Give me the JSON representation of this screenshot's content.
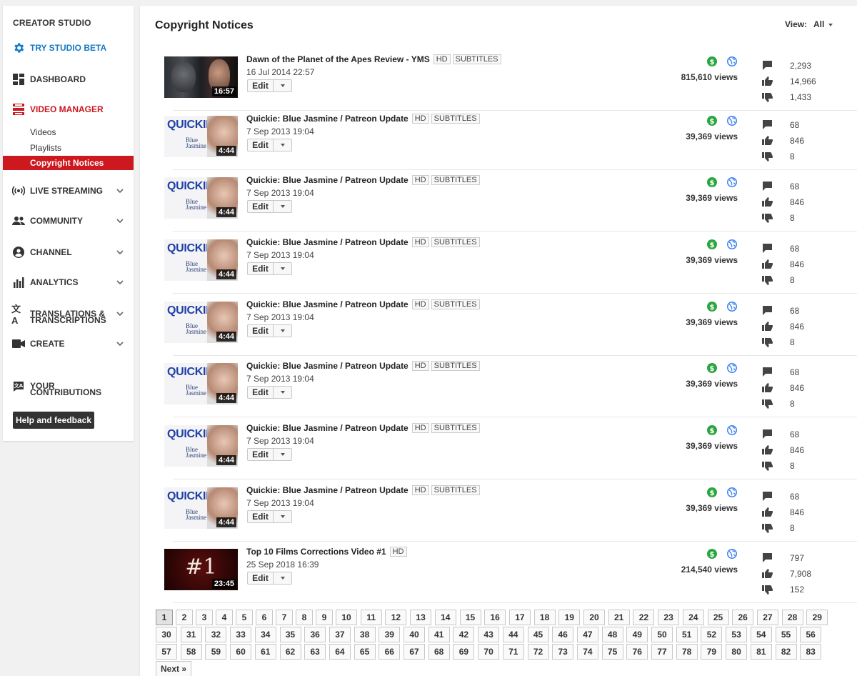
{
  "sidebar": {
    "brand": "CREATOR STUDIO",
    "try_beta": "TRY STUDIO BETA",
    "dashboard": "DASHBOARD",
    "video_manager": "VIDEO MANAGER",
    "sub": {
      "videos": "Videos",
      "playlists": "Playlists",
      "copyright": "Copyright Notices"
    },
    "live": "LIVE STREAMING",
    "community": "COMMUNITY",
    "channel": "CHANNEL",
    "analytics": "ANALYTICS",
    "translations_1": "TRANSLATIONS &",
    "translations_2": "TRANSCRIPTIONS",
    "create": "CREATE",
    "contrib_1": "YOUR",
    "contrib_2": "CONTRIBUTIONS",
    "help": "Help and feedback"
  },
  "header": {
    "title": "Copyright Notices",
    "view_label": "View:",
    "view_value": "All"
  },
  "edit_label": "Edit",
  "colors": {
    "red": "#cc181e",
    "blue": "#167ac6",
    "green": "#2ba640",
    "globe": "#4285f4"
  },
  "videos": [
    {
      "title": "Dawn of the Planet of the Apes Review - YMS",
      "hd": "HD",
      "subtitles": "SUBTITLES",
      "date": "16 Jul 2014 22:57",
      "duration": "16:57",
      "views": "815,610 views",
      "comments": "2,293",
      "likes": "14,966",
      "dislikes": "1,433"
    },
    {
      "title": "Quickie: Blue Jasmine / Patreon Update",
      "hd": "HD",
      "subtitles": "SUBTITLES",
      "date": "7 Sep 2013 19:04",
      "duration": "4:44",
      "views": "39,369 views",
      "comments": "68",
      "likes": "846",
      "dislikes": "8",
      "thumb_word": "QUICKIE"
    },
    {
      "title": "Quickie: Blue Jasmine / Patreon Update",
      "hd": "HD",
      "subtitles": "SUBTITLES",
      "date": "7 Sep 2013 19:04",
      "duration": "4:44",
      "views": "39,369 views",
      "comments": "68",
      "likes": "846",
      "dislikes": "8",
      "thumb_word": "QUICKIE"
    },
    {
      "title": "Quickie: Blue Jasmine / Patreon Update",
      "hd": "HD",
      "subtitles": "SUBTITLES",
      "date": "7 Sep 2013 19:04",
      "duration": "4:44",
      "views": "39,369 views",
      "comments": "68",
      "likes": "846",
      "dislikes": "8",
      "thumb_word": "QUICKIE"
    },
    {
      "title": "Quickie: Blue Jasmine / Patreon Update",
      "hd": "HD",
      "subtitles": "SUBTITLES",
      "date": "7 Sep 2013 19:04",
      "duration": "4:44",
      "views": "39,369 views",
      "comments": "68",
      "likes": "846",
      "dislikes": "8",
      "thumb_word": "QUICKIE"
    },
    {
      "title": "Quickie: Blue Jasmine / Patreon Update",
      "hd": "HD",
      "subtitles": "SUBTITLES",
      "date": "7 Sep 2013 19:04",
      "duration": "4:44",
      "views": "39,369 views",
      "comments": "68",
      "likes": "846",
      "dislikes": "8",
      "thumb_word": "QUICKIE"
    },
    {
      "title": "Quickie: Blue Jasmine / Patreon Update",
      "hd": "HD",
      "subtitles": "SUBTITLES",
      "date": "7 Sep 2013 19:04",
      "duration": "4:44",
      "views": "39,369 views",
      "comments": "68",
      "likes": "846",
      "dislikes": "8",
      "thumb_word": "QUICKIE"
    },
    {
      "title": "Quickie: Blue Jasmine / Patreon Update",
      "hd": "HD",
      "subtitles": "SUBTITLES",
      "date": "7 Sep 2013 19:04",
      "duration": "4:44",
      "views": "39,369 views",
      "comments": "68",
      "likes": "846",
      "dislikes": "8",
      "thumb_word": "QUICKIE"
    },
    {
      "title": "Top 10 Films Corrections Video #1",
      "hd": "HD",
      "subtitles": "",
      "date": "25 Sep 2018 16:39",
      "duration": "23:45",
      "views": "214,540 views",
      "comments": "797",
      "likes": "7,908",
      "dislikes": "152",
      "thumb_word": "#1"
    }
  ],
  "pagination": {
    "current": "1",
    "pages": [
      "1",
      "2",
      "3",
      "4",
      "5",
      "6",
      "7",
      "8",
      "9",
      "10",
      "11",
      "12",
      "13",
      "14",
      "15",
      "16",
      "17",
      "18",
      "19",
      "20",
      "21",
      "22",
      "23",
      "24",
      "25",
      "26",
      "27",
      "28",
      "29",
      "30",
      "31",
      "32",
      "33",
      "34",
      "35",
      "36",
      "37",
      "38",
      "39",
      "40",
      "41",
      "42",
      "43",
      "44",
      "45",
      "46",
      "47",
      "48",
      "49",
      "50",
      "51",
      "52",
      "53",
      "54",
      "55",
      "56",
      "57",
      "58",
      "59",
      "60",
      "61",
      "62",
      "63",
      "64",
      "65",
      "66",
      "67",
      "68",
      "69",
      "70",
      "71",
      "72",
      "73",
      "74",
      "75",
      "76",
      "77",
      "78",
      "79",
      "80",
      "81",
      "82",
      "83"
    ],
    "next": "Next »"
  }
}
